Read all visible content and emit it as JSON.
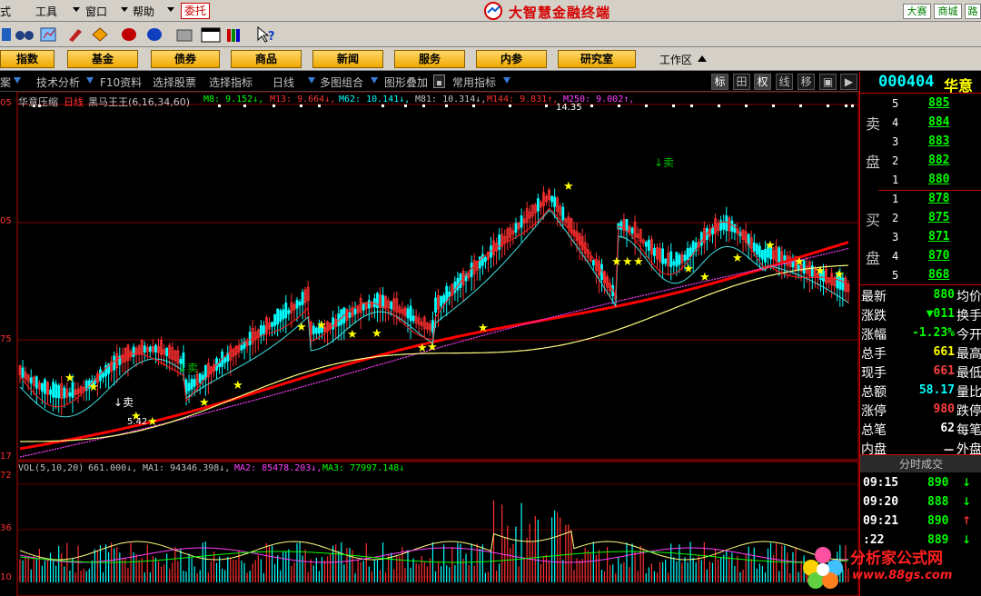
{
  "menubar": {
    "items": [
      "式",
      "工具",
      "窗口",
      "帮助"
    ],
    "weituo": "委托",
    "brand": "大智慧金融终端",
    "right_buttons": [
      "大赛",
      "商城",
      "路"
    ]
  },
  "navbar": {
    "tabs": [
      "指数",
      "基金",
      "债券",
      "商品",
      "新闻",
      "服务",
      "内参",
      "研究室"
    ],
    "workzone": "工作区"
  },
  "funcbar": {
    "items": [
      "案",
      "技术分析",
      "F10资料",
      "选择股票",
      "选择指标",
      "日线",
      "多图组合",
      "图形叠加",
      "常用指标"
    ],
    "right_buttons": [
      "标",
      "田",
      "权",
      "线",
      "移",
      "▣",
      "▶"
    ]
  },
  "chart": {
    "name_line": "华意压缩",
    "period": "日线",
    "indicator": "黑马王王(6,16,34,60)",
    "ma_legend": [
      {
        "text": "M8: 9.152↓,",
        "color": "#c0c0c0"
      },
      {
        "text": "M13: 9.664↓,",
        "color": "#ff3030"
      },
      {
        "text": "M62: 10.141↓,",
        "color": "#00ffff"
      },
      {
        "text": "M81: 10.314↓,",
        "color": "#c0c0c0"
      },
      {
        "text": "M144: 9.831↑,",
        "color": "#ff3030"
      },
      {
        "text": "M250: 9.002↑,",
        "color": "#ff40ff"
      }
    ],
    "peak_label": "14.35",
    "low_label": "5.42",
    "sell_label_1": "↓卖",
    "sell_label_2": "↓卖",
    "sell_label_3": "↓卖",
    "y_axis": [
      "05",
      "75",
      "17"
    ],
    "vol_legend": [
      {
        "text": "VOL(5,10,20)",
        "color": "#c0c0c0"
      },
      {
        "text": "661.000↓,",
        "color": "#c0c0c0"
      },
      {
        "text": "MA1: 94346.398↓,",
        "color": "#c0c0c0"
      },
      {
        "text": "MA2: 85478.203↓,",
        "color": "#ff40ff"
      },
      {
        "text": "MA3: 77997.148↓",
        "color": "#00ff00"
      }
    ],
    "vol_axis": [
      "72",
      "36",
      "10"
    ],
    "colors": {
      "up": "#ff3030",
      "down": "#00ffff",
      "ma_main": "#ff0000",
      "ma_long": "#ff40ff",
      "ma_yellow": "#ffff80",
      "ma_cyan": "#40e0e0"
    }
  },
  "panel": {
    "code": "000404",
    "name": "华意",
    "sell_label": [
      "卖",
      "盘"
    ],
    "buy_label": [
      "买",
      "盘"
    ],
    "asks": [
      {
        "level": "5",
        "price": "885"
      },
      {
        "level": "4",
        "price": "884"
      },
      {
        "level": "3",
        "price": "883"
      },
      {
        "level": "2",
        "price": "882"
      },
      {
        "level": "1",
        "price": "880"
      }
    ],
    "bids": [
      {
        "level": "1",
        "price": "878"
      },
      {
        "level": "2",
        "price": "875"
      },
      {
        "level": "3",
        "price": "871"
      },
      {
        "level": "4",
        "price": "870"
      },
      {
        "level": "5",
        "price": "868"
      }
    ],
    "quotes": [
      {
        "label": "最新",
        "value": "880",
        "color": "#00ff00",
        "label2": "均价"
      },
      {
        "label": "涨跌",
        "value": "▼011",
        "color": "#00ff00",
        "label2": "换手"
      },
      {
        "label": "涨幅",
        "value": "-1.23%",
        "color": "#00ff00",
        "label2": "今开"
      },
      {
        "label": "总手",
        "value": "661",
        "color": "#ffff00",
        "label2": "最高"
      },
      {
        "label": "现手",
        "value": "661",
        "color": "#ff4040",
        "label2": "最低"
      },
      {
        "label": "总额",
        "value": "58.17",
        "color": "#00ffff",
        "label2": "量比"
      },
      {
        "label": "涨停",
        "value": "980",
        "color": "#ff4040",
        "label2": "跌停"
      },
      {
        "label": "总笔",
        "value": "62",
        "color": "#ffffff",
        "label2": "每笔"
      },
      {
        "label": "内盘",
        "value": "－",
        "color": "#ffffff",
        "label2": "外盘"
      }
    ],
    "ticks_title": "分时成交",
    "ticks": [
      {
        "time": "09:15",
        "price": "890",
        "arrow": "↓",
        "arrow_color": "#00ff00"
      },
      {
        "time": "09:20",
        "price": "888",
        "arrow": "↓",
        "arrow_color": "#00ff00"
      },
      {
        "time": "09:21",
        "price": "890",
        "arrow": "↑",
        "arrow_color": "#ff3030"
      },
      {
        "time": ":22",
        "price": "889",
        "arrow": "↓",
        "arrow_color": "#00ff00"
      }
    ]
  },
  "watermark": {
    "text": "分析家公式网",
    "url": "www.88gs.com"
  }
}
